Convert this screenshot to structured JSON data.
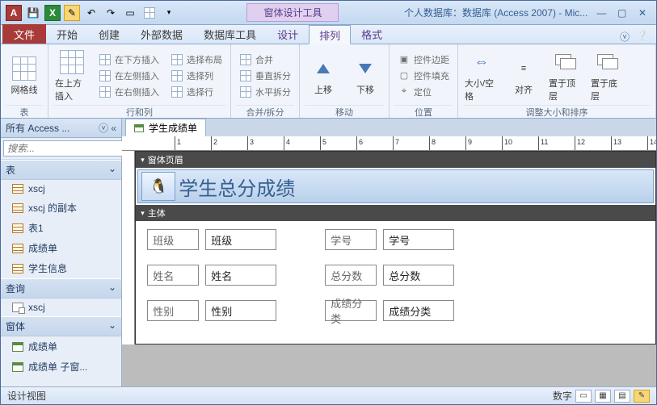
{
  "titlebar": {
    "context_tool_label": "窗体设计工具",
    "app_title": "个人数据库：数据库 (Access 2007) - Mic..."
  },
  "qat": {
    "save_icon": "💾",
    "excel_icon": "X",
    "undo": "↶",
    "redo": "↷"
  },
  "ribbon_tabs": {
    "file": "文件",
    "home": "开始",
    "create": "创建",
    "external": "外部数据",
    "dbtools": "数据库工具",
    "design": "设计",
    "arrange": "排列",
    "format": "格式"
  },
  "ribbon": {
    "group_table": {
      "gridlines": "网格线",
      "label": "表"
    },
    "group_rowscols": {
      "insert_above": "在上方插入",
      "insert_below": "在下方插入",
      "insert_left": "在左侧插入",
      "insert_right": "在右侧插入",
      "select_layout": "选择布局",
      "select_col": "选择列",
      "select_row": "选择行",
      "label": "行和列"
    },
    "group_merge": {
      "merge": "合并",
      "vsplit": "垂直拆分",
      "hsplit": "水平拆分",
      "label": "合并/拆分"
    },
    "group_move": {
      "up": "上移",
      "down": "下移",
      "label": "移动"
    },
    "group_pos": {
      "margins": "控件边距",
      "padding": "控件填充",
      "anchor": "定位",
      "label": "位置"
    },
    "group_size": {
      "sizespace": "大小/空格",
      "align": "对齐",
      "front": "置于顶层",
      "back": "置于底层",
      "label": "调整大小和排序"
    }
  },
  "navpane": {
    "title": "所有 Access ...",
    "search_placeholder": "搜索...",
    "groups": {
      "tables": {
        "header": "表",
        "items": [
          "xscj",
          "xscj 的副本",
          "表1",
          "成绩单",
          "学生信息"
        ]
      },
      "queries": {
        "header": "查询",
        "items": [
          "xscj"
        ]
      },
      "forms": {
        "header": "窗体",
        "items": [
          "成绩单",
          "成绩单 子窗..."
        ]
      }
    }
  },
  "document": {
    "tab_label": "学生成绩单",
    "sections": {
      "header": "窗体页眉",
      "detail": "主体"
    },
    "form_title": "学生总分成绩",
    "fields": [
      {
        "label": "班级",
        "control": "班级"
      },
      {
        "label": "学号",
        "control": "学号"
      },
      {
        "label": "姓名",
        "control": "姓名"
      },
      {
        "label": "总分数",
        "control": "总分数"
      },
      {
        "label": "性别",
        "control": "性别"
      },
      {
        "label": "成绩分类",
        "control": "成绩分类"
      }
    ]
  },
  "statusbar": {
    "left": "设计视图",
    "numlock": "数字"
  }
}
